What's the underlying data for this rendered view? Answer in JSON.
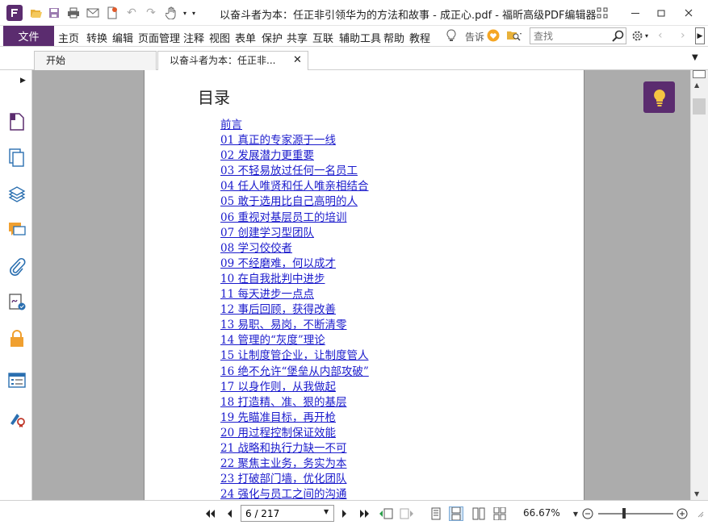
{
  "window": {
    "title": "以奋斗者为本：任正非引领华为的方法和故事 - 成正心.pdf - 福昕高级PDF编辑器"
  },
  "menu": {
    "file_label": "文件",
    "items": [
      "主页",
      "转换",
      "编辑",
      "页面管理",
      "注释",
      "视图",
      "表单",
      "保护",
      "共享",
      "互联",
      "辅助工具",
      "帮助",
      "教程"
    ],
    "tell_label": "告诉",
    "search_placeholder": "查找"
  },
  "tabs": [
    {
      "label": "开始",
      "active": false
    },
    {
      "label": "以奋斗者为本：任正非...",
      "active": true
    }
  ],
  "document": {
    "heading": "目录",
    "toc": [
      "前言",
      "01 真正的专家源于一线",
      "02 发展潜力更重要",
      "03 不轻易放过任何一名员工",
      "04 任人唯贤和任人唯亲相结合",
      "05 敢于选用比自己高明的人",
      "06 重视对基层员工的培训",
      "07 创建学习型团队",
      "08 学习佼佼者",
      "09 不经磨难，何以成才",
      "10 在自我批判中进步",
      "11 每天进步一点点",
      "12 事后回顾，获得改善",
      "13 易职、易岗，不断清零",
      "14 管理的“灰度”理论",
      "15 让制度管企业，让制度管人",
      "16 绝不允许“堡垒从内部攻破”",
      "17 以身作则，从我做起",
      "18 打造精、准、狠的基层",
      "19 先瞄准目标，再开枪",
      "20 用过程控制保证效能",
      "21 战略和执行力缺一不可",
      "22 聚焦主业务，务实为本",
      "23 打破部门墙，优化团队",
      "24 强化与员工之间的沟通"
    ]
  },
  "statusbar": {
    "page_value": "6 / 217",
    "zoom": "66.67%"
  },
  "colors": {
    "accent": "#5b2c6f",
    "link": "#1a1acc",
    "doc_background": "#acacac"
  }
}
